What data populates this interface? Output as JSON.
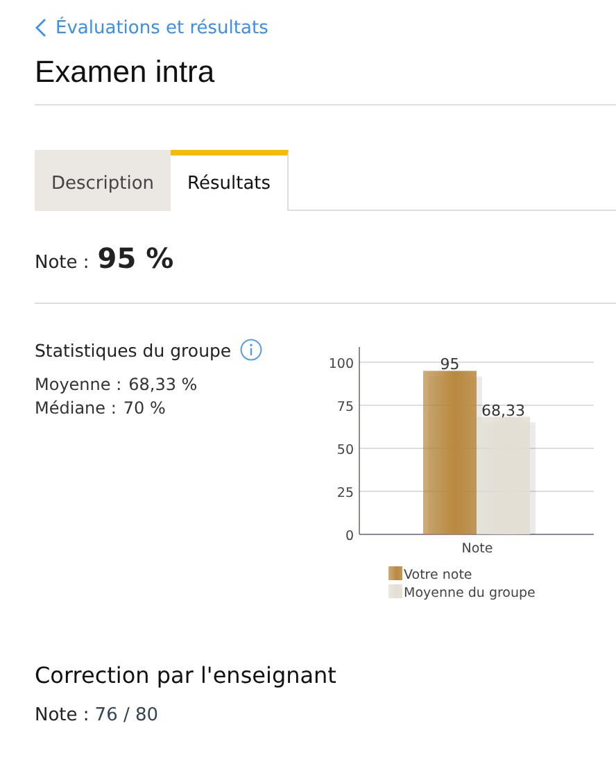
{
  "back_link": {
    "label": "Évaluations et résultats"
  },
  "title": "Examen intra",
  "tabs": [
    {
      "label": "Description",
      "selected": false
    },
    {
      "label": "Résultats",
      "selected": true
    }
  ],
  "grade": {
    "label": "Note :",
    "value": "95 %"
  },
  "group_stats": {
    "title": "Statistiques du groupe",
    "stats": [
      {
        "label": "Moyenne :",
        "value": "68,33 %"
      },
      {
        "label": "Médiane :",
        "value": "70 %"
      }
    ],
    "chart_data": {
      "type": "bar",
      "categories": [
        "Note"
      ],
      "series": [
        {
          "name": "Votre note",
          "color": "#b8893f",
          "values": [
            95
          ]
        },
        {
          "name": "Moyenne du groupe",
          "color": "#e2ded3",
          "values": [
            68.33
          ]
        }
      ],
      "ylim": [
        0,
        100
      ],
      "grid": true,
      "legend": true,
      "yticks": [
        0,
        25,
        50,
        75,
        100
      ],
      "value_labels": [
        "95",
        "68,33"
      ]
    }
  },
  "teacher_correction": {
    "title": "Correction par l'enseignant",
    "label": "Note :",
    "value": "76 / 80"
  }
}
